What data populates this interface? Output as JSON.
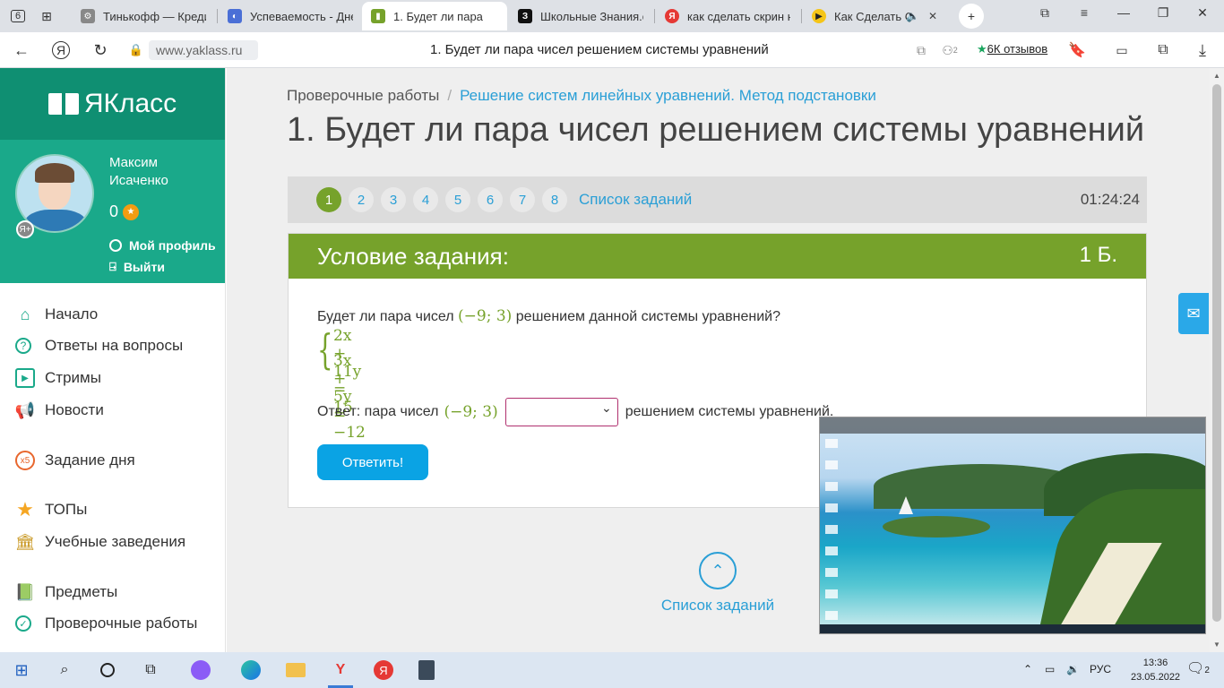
{
  "browser": {
    "tab_counter": "6",
    "tabs": [
      {
        "title": "Тинькофф — Креди",
        "fav_color": "#888888"
      },
      {
        "title": "Успеваемость - Дне",
        "fav_color": "#4a6fd6"
      },
      {
        "title": "1. Будет ли пара ",
        "fav_color": "#76a22b",
        "active": true
      },
      {
        "title": "Школьные Знания.c",
        "fav_color": "#111111"
      },
      {
        "title": "как сделать скрин н",
        "fav_color": "#e53935"
      },
      {
        "title": "Как Сделать С",
        "fav_color": "#f5c518"
      }
    ],
    "url": "www.yaklass.ru",
    "page_title": "1. Будет ли пара чисел решением системы уравнений",
    "reviews": "6К отзывов",
    "ext_count": "2"
  },
  "sidebar": {
    "logo": "ЯКласс",
    "user_name": "Максим Исаченко",
    "score": "0",
    "profile_link": "Мой профиль",
    "logout_link": "Выйти",
    "menu": [
      {
        "label": "Начало",
        "icon": "home-icon"
      },
      {
        "label": "Ответы на вопросы",
        "icon": "question-icon"
      },
      {
        "label": "Стримы",
        "icon": "play-icon"
      },
      {
        "label": "Новости",
        "icon": "megaphone-icon"
      },
      {
        "label": "Задание дня",
        "icon": "x5-icon"
      },
      {
        "label": "ТОПы",
        "icon": "star-icon"
      },
      {
        "label": "Учебные заведения",
        "icon": "building-icon"
      },
      {
        "label": "Предметы",
        "icon": "books-icon"
      },
      {
        "label": "Проверочные работы",
        "icon": "check-icon"
      }
    ]
  },
  "main": {
    "breadcrumb_root": "Проверочные работы",
    "breadcrumb_current": "Решение систем линейных уравнений. Метод подстановки",
    "title": "1. Будет ли пара чисел решением системы уравнений",
    "task_numbers": [
      "1",
      "2",
      "3",
      "4",
      "5",
      "6",
      "7",
      "8"
    ],
    "current_task": "1",
    "task_list_label": "Список заданий",
    "timer": "01:24:24",
    "condition_title": "Условие задания:",
    "points": "1 Б.",
    "question_prefix": "Будет ли пара чисел",
    "question_pair": "(−9; 3)",
    "question_suffix": "решением данной системы уравнений?",
    "eq1": "2x + 11y = 15",
    "eq2": "3x + 5y = −12",
    "answer_prefix": "Ответ: пара чисел",
    "answer_pair": "(−9; 3)",
    "answer_suffix": "решением системы уравнений.",
    "answer_select_value": "",
    "submit_label": "Ответить!",
    "bottom_list_label": "Список заданий"
  },
  "taskbar": {
    "lang": "РУС",
    "time": "13:36",
    "date": "23.05.2022",
    "notif_count": "2"
  }
}
